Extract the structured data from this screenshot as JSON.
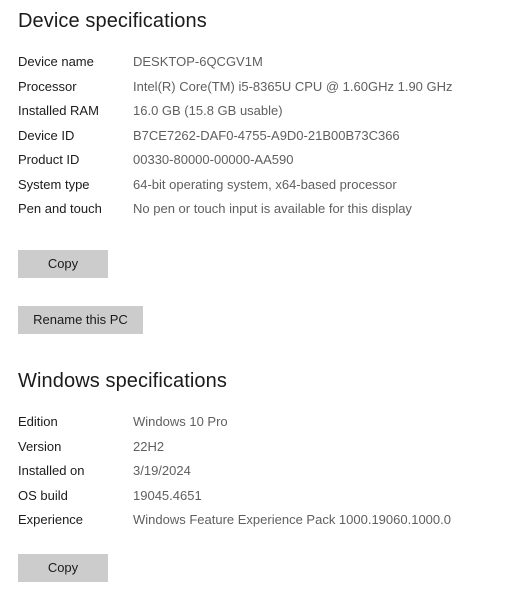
{
  "device_specifications": {
    "heading": "Device specifications",
    "rows": [
      {
        "label": "Device name",
        "value": "DESKTOP-6QCGV1M"
      },
      {
        "label": "Processor",
        "value": "Intel(R) Core(TM) i5-8365U CPU @ 1.60GHz   1.90 GHz"
      },
      {
        "label": "Installed RAM",
        "value": "16.0 GB (15.8 GB usable)"
      },
      {
        "label": "Device ID",
        "value": "B7CE7262-DAF0-4755-A9D0-21B00B73C366"
      },
      {
        "label": "Product ID",
        "value": "00330-80000-00000-AA590"
      },
      {
        "label": "System type",
        "value": "64-bit operating system, x64-based processor"
      },
      {
        "label": "Pen and touch",
        "value": "No pen or touch input is available for this display"
      }
    ],
    "copy_label": "Copy",
    "rename_label": "Rename this PC"
  },
  "windows_specifications": {
    "heading": "Windows specifications",
    "rows": [
      {
        "label": "Edition",
        "value": "Windows 10 Pro"
      },
      {
        "label": "Version",
        "value": "22H2"
      },
      {
        "label": "Installed on",
        "value": "3/19/2024"
      },
      {
        "label": "OS build",
        "value": "19045.4651"
      },
      {
        "label": "Experience",
        "value": "Windows Feature Experience Pack 1000.19060.1000.0"
      }
    ],
    "copy_label": "Copy"
  },
  "colors": {
    "background": "#ffffff",
    "label_text": "#1b1b1b",
    "value_text": "#5f5f5f",
    "button_background": "#cccccc"
  }
}
